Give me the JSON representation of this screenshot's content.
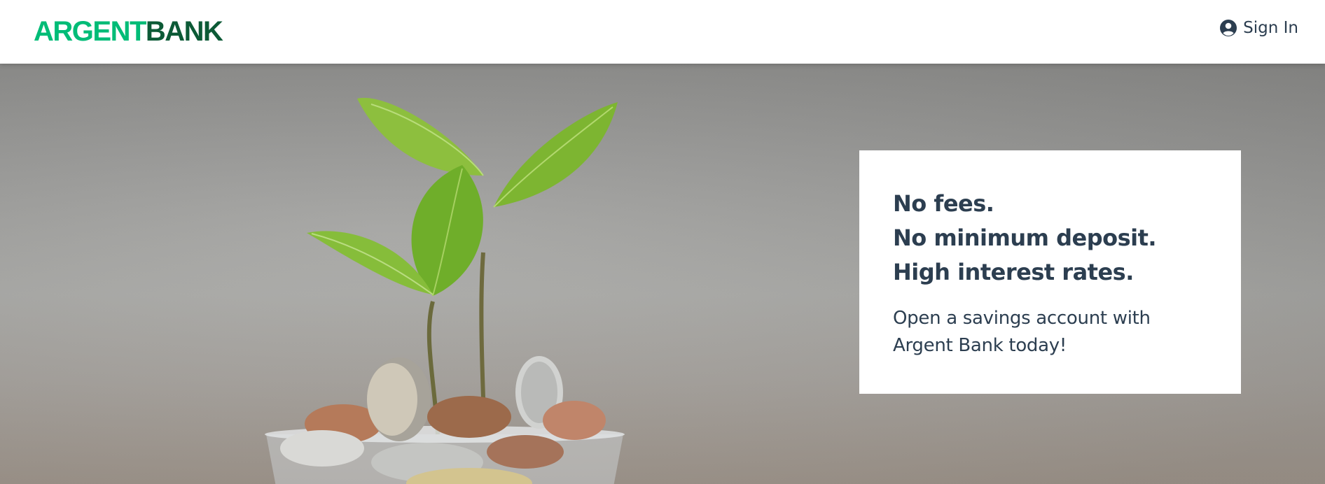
{
  "header": {
    "logo": {
      "first": "ARGENT",
      "second": "BANK"
    },
    "sign_in_label": "Sign In",
    "sign_in_icon": "user-circle-icon"
  },
  "hero": {
    "image": "plant-growing-from-coins-jar",
    "card": {
      "lines": [
        "No fees.",
        "No minimum deposit.",
        "High interest rates."
      ],
      "subtitle": "Open a savings account with Argent Bank today!"
    }
  },
  "colors": {
    "brand_green": "#00bc77",
    "brand_dark_green": "#0c5a36",
    "text": "#2c3e50"
  }
}
